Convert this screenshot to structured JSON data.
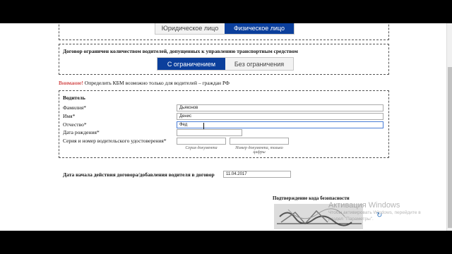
{
  "person_type": {
    "options": [
      "Юридическое лицо",
      "Физическое лицо"
    ],
    "selected": "Физическое лицо"
  },
  "drivers_limit": {
    "title": "Договор ограничен количеством водителей, допущенных к управлению транспортным средством",
    "options": [
      "С ограничением",
      "Без ограничения"
    ],
    "selected": "С ограничением"
  },
  "warning": {
    "prefix": "Внимание!",
    "text": "Определить КБМ возможно только для водителей – граждан РФ"
  },
  "driver": {
    "section_title": "Водитель",
    "last_name_label": "Фамилия*",
    "last_name_value": "Дьяконов",
    "first_name_label": "Имя*",
    "first_name_value": "Денис",
    "patronymic_label": "Отчество*",
    "patronymic_value": "Фед",
    "birth_date_label": "Дата рождения*",
    "birth_date_value": "",
    "license_label": "Серия и номер водительского удостоверения*",
    "license_series_value": "",
    "license_number_value": "",
    "license_series_hint": "Серия документа",
    "license_number_hint": "Номер документа, только цифры"
  },
  "contract_start": {
    "label": "Дата начала действия договора/добавления водителя в договор",
    "value": "11.04.2017"
  },
  "captcha": {
    "title": "Подтверждение кода безопасности",
    "refresh_icon": "refresh-icon"
  },
  "watermark": {
    "title": "Активация Windows",
    "line1": "Чтобы активировать Windows, перейдите в",
    "line2": "раздел \"Параметры\"."
  },
  "colors": {
    "accent": "#0b3f9c",
    "warning": "#c00000"
  }
}
